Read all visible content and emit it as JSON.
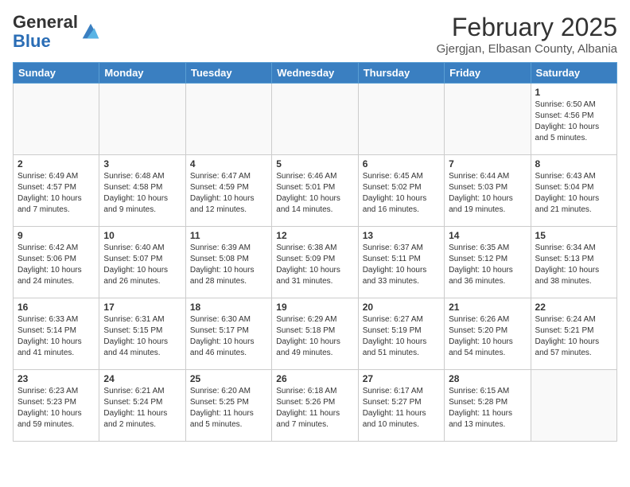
{
  "header": {
    "logo_general": "General",
    "logo_blue": "Blue",
    "month_title": "February 2025",
    "location": "Gjergjan, Elbasan County, Albania"
  },
  "weekdays": [
    "Sunday",
    "Monday",
    "Tuesday",
    "Wednesday",
    "Thursday",
    "Friday",
    "Saturday"
  ],
  "weeks": [
    [
      {
        "day": "",
        "info": ""
      },
      {
        "day": "",
        "info": ""
      },
      {
        "day": "",
        "info": ""
      },
      {
        "day": "",
        "info": ""
      },
      {
        "day": "",
        "info": ""
      },
      {
        "day": "",
        "info": ""
      },
      {
        "day": "1",
        "info": "Sunrise: 6:50 AM\nSunset: 4:56 PM\nDaylight: 10 hours and 5 minutes."
      }
    ],
    [
      {
        "day": "2",
        "info": "Sunrise: 6:49 AM\nSunset: 4:57 PM\nDaylight: 10 hours and 7 minutes."
      },
      {
        "day": "3",
        "info": "Sunrise: 6:48 AM\nSunset: 4:58 PM\nDaylight: 10 hours and 9 minutes."
      },
      {
        "day": "4",
        "info": "Sunrise: 6:47 AM\nSunset: 4:59 PM\nDaylight: 10 hours and 12 minutes."
      },
      {
        "day": "5",
        "info": "Sunrise: 6:46 AM\nSunset: 5:01 PM\nDaylight: 10 hours and 14 minutes."
      },
      {
        "day": "6",
        "info": "Sunrise: 6:45 AM\nSunset: 5:02 PM\nDaylight: 10 hours and 16 minutes."
      },
      {
        "day": "7",
        "info": "Sunrise: 6:44 AM\nSunset: 5:03 PM\nDaylight: 10 hours and 19 minutes."
      },
      {
        "day": "8",
        "info": "Sunrise: 6:43 AM\nSunset: 5:04 PM\nDaylight: 10 hours and 21 minutes."
      }
    ],
    [
      {
        "day": "9",
        "info": "Sunrise: 6:42 AM\nSunset: 5:06 PM\nDaylight: 10 hours and 24 minutes."
      },
      {
        "day": "10",
        "info": "Sunrise: 6:40 AM\nSunset: 5:07 PM\nDaylight: 10 hours and 26 minutes."
      },
      {
        "day": "11",
        "info": "Sunrise: 6:39 AM\nSunset: 5:08 PM\nDaylight: 10 hours and 28 minutes."
      },
      {
        "day": "12",
        "info": "Sunrise: 6:38 AM\nSunset: 5:09 PM\nDaylight: 10 hours and 31 minutes."
      },
      {
        "day": "13",
        "info": "Sunrise: 6:37 AM\nSunset: 5:11 PM\nDaylight: 10 hours and 33 minutes."
      },
      {
        "day": "14",
        "info": "Sunrise: 6:35 AM\nSunset: 5:12 PM\nDaylight: 10 hours and 36 minutes."
      },
      {
        "day": "15",
        "info": "Sunrise: 6:34 AM\nSunset: 5:13 PM\nDaylight: 10 hours and 38 minutes."
      }
    ],
    [
      {
        "day": "16",
        "info": "Sunrise: 6:33 AM\nSunset: 5:14 PM\nDaylight: 10 hours and 41 minutes."
      },
      {
        "day": "17",
        "info": "Sunrise: 6:31 AM\nSunset: 5:15 PM\nDaylight: 10 hours and 44 minutes."
      },
      {
        "day": "18",
        "info": "Sunrise: 6:30 AM\nSunset: 5:17 PM\nDaylight: 10 hours and 46 minutes."
      },
      {
        "day": "19",
        "info": "Sunrise: 6:29 AM\nSunset: 5:18 PM\nDaylight: 10 hours and 49 minutes."
      },
      {
        "day": "20",
        "info": "Sunrise: 6:27 AM\nSunset: 5:19 PM\nDaylight: 10 hours and 51 minutes."
      },
      {
        "day": "21",
        "info": "Sunrise: 6:26 AM\nSunset: 5:20 PM\nDaylight: 10 hours and 54 minutes."
      },
      {
        "day": "22",
        "info": "Sunrise: 6:24 AM\nSunset: 5:21 PM\nDaylight: 10 hours and 57 minutes."
      }
    ],
    [
      {
        "day": "23",
        "info": "Sunrise: 6:23 AM\nSunset: 5:23 PM\nDaylight: 10 hours and 59 minutes."
      },
      {
        "day": "24",
        "info": "Sunrise: 6:21 AM\nSunset: 5:24 PM\nDaylight: 11 hours and 2 minutes."
      },
      {
        "day": "25",
        "info": "Sunrise: 6:20 AM\nSunset: 5:25 PM\nDaylight: 11 hours and 5 minutes."
      },
      {
        "day": "26",
        "info": "Sunrise: 6:18 AM\nSunset: 5:26 PM\nDaylight: 11 hours and 7 minutes."
      },
      {
        "day": "27",
        "info": "Sunrise: 6:17 AM\nSunset: 5:27 PM\nDaylight: 11 hours and 10 minutes."
      },
      {
        "day": "28",
        "info": "Sunrise: 6:15 AM\nSunset: 5:28 PM\nDaylight: 11 hours and 13 minutes."
      },
      {
        "day": "",
        "info": ""
      }
    ]
  ]
}
